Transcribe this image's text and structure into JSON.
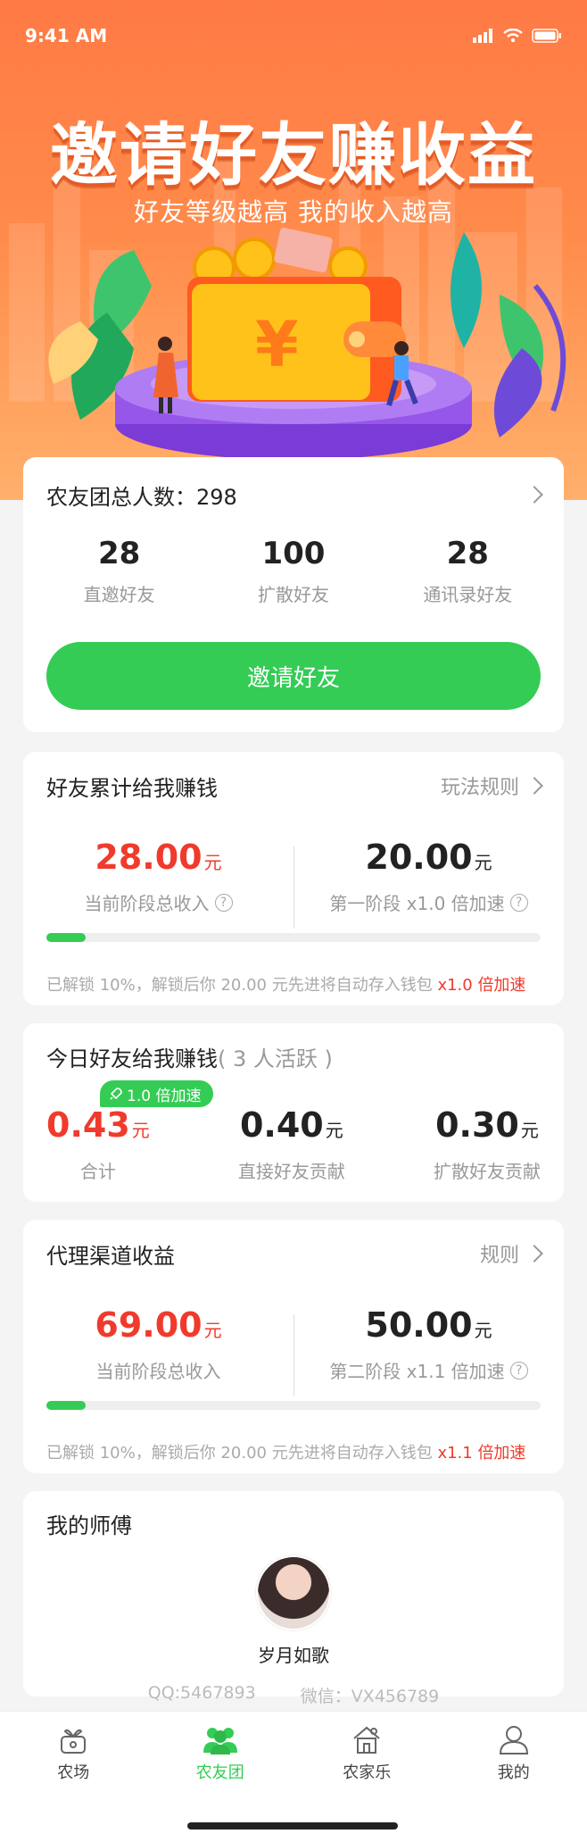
{
  "status_bar": {
    "time": "9:41 AM"
  },
  "hero": {
    "title": "邀请好友赚收益",
    "subtitle": "好友等级越高 我的收入越高",
    "currency_symbol": "¥"
  },
  "team": {
    "total_label": "农友团总人数：298",
    "stats": [
      {
        "value": "28",
        "label": "直邀好友"
      },
      {
        "value": "100",
        "label": "扩散好友"
      },
      {
        "value": "28",
        "label": "通讯录好友"
      }
    ],
    "invite_button": "邀请好友"
  },
  "friend_earnings": {
    "title": "好友累计给我赚钱",
    "rule_link": "玩法规则",
    "current_amount": "28.00",
    "current_unit": "元",
    "current_label": "当前阶段总收入",
    "stage_amount": "20.00",
    "stage_unit": "元",
    "stage_label": "第一阶段 x1.0 倍加速",
    "progress_pct": 8,
    "note": "已解锁 10%，解锁后你 20.00 元先进将自动存入钱包",
    "note_accel": "x1.0 倍加速"
  },
  "today": {
    "title": "今日好友给我赚钱",
    "active_count": "( 3 人活跃 )",
    "boost_badge": "1.0 倍加速",
    "items": [
      {
        "amount": "0.43",
        "unit": "元",
        "label": "合计"
      },
      {
        "amount": "0.40",
        "unit": "元",
        "label": "直接好友贡献"
      },
      {
        "amount": "0.30",
        "unit": "元",
        "label": "扩散好友贡献"
      }
    ]
  },
  "agent": {
    "title": "代理渠道收益",
    "rule_link": "规则",
    "current_amount": "69.00",
    "current_unit": "元",
    "current_label": "当前阶段总收入",
    "stage_amount": "50.00",
    "stage_unit": "元",
    "stage_label": "第二阶段 x1.1 倍加速",
    "progress_pct": 8,
    "note": "已解锁 10%，解锁后你 20.00 元先进将自动存入钱包",
    "note_accel": "x1.1 倍加速"
  },
  "master": {
    "title": "我的师傅",
    "name": "岁月如歌",
    "qq": "QQ:5467893",
    "wechat": "微信：VX456789"
  },
  "tabbar": {
    "items": [
      {
        "label": "农场",
        "icon": "farm-icon"
      },
      {
        "label": "农友团",
        "icon": "group-icon",
        "active": true
      },
      {
        "label": "农家乐",
        "icon": "farmhouse-icon"
      },
      {
        "label": "我的",
        "icon": "profile-icon"
      }
    ]
  },
  "colors": {
    "brand_green": "#34cc55",
    "accent_red": "#f03a2c",
    "hero_orange": "#ff7a45"
  }
}
